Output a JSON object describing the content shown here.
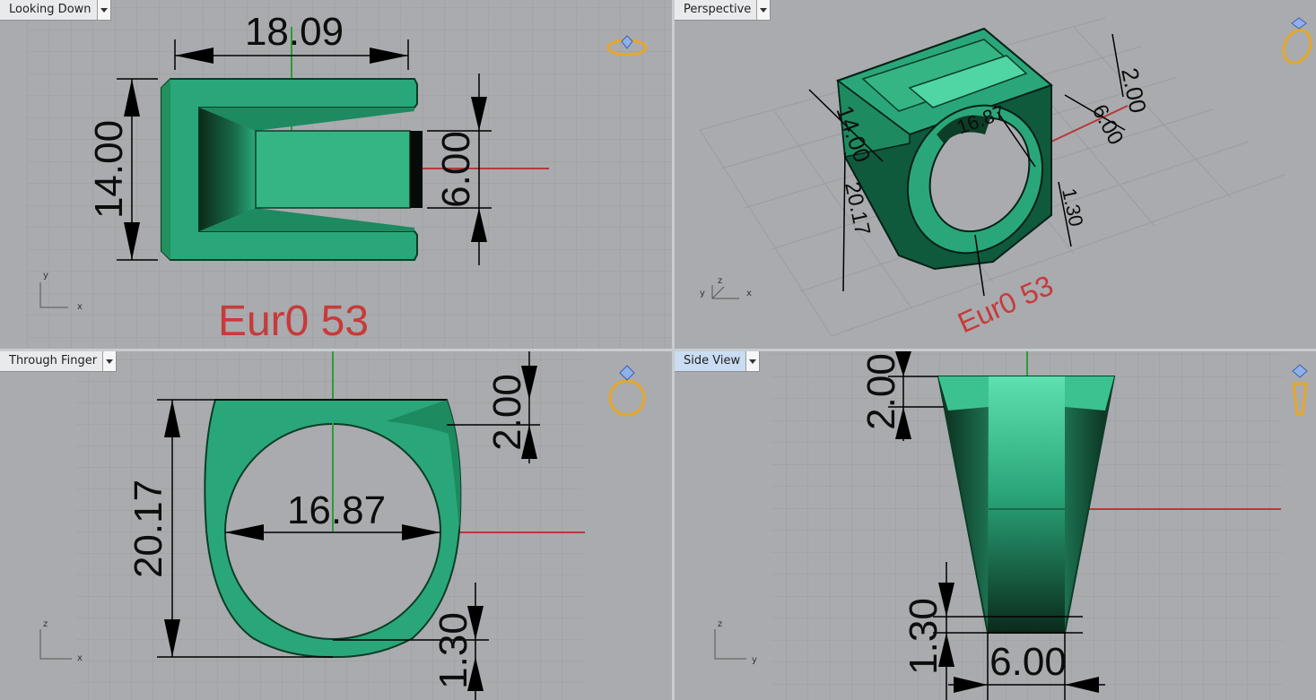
{
  "viewports": [
    {
      "title": "Looking Down",
      "active": false,
      "axes": {
        "v": "y",
        "h": "x"
      },
      "dimensions": [
        "18.09",
        "14.00",
        "6.00"
      ],
      "size_label": "Eur0 53"
    },
    {
      "title": "Perspective",
      "active": false,
      "axes": {
        "v": "y",
        "z": "z",
        "h": "x"
      },
      "dimensions": [
        "14.00",
        "2.00",
        "6.00",
        "20.17",
        "1.30",
        "16.87",
        "2.00"
      ],
      "size_label": "Eur0 53"
    },
    {
      "title": "Through Finger",
      "active": false,
      "axes": {
        "v": "z",
        "h": "x"
      },
      "dimensions": [
        "20.17",
        "16.87",
        "2.00",
        "1.30"
      ]
    },
    {
      "title": "Side View",
      "active": true,
      "axes": {
        "v": "z",
        "h": "y"
      },
      "dimensions": [
        "2.00",
        "1.30",
        "6.00"
      ]
    }
  ],
  "icons": [
    "ring-top-icon",
    "ring-perspective-icon",
    "ring-front-icon",
    "ring-side-icon",
    "dropdown-arrow-icon"
  ],
  "colors": {
    "viewport_bg": "#a9abae",
    "grid": "#9a9c9f",
    "model": "#2aa77a",
    "model_dark": "#0b3d27",
    "model_light": "#4fd6a4",
    "x_axis": "#b8383a",
    "y_axis": "#2f9a3a",
    "annotation_red": "#c83a3a",
    "active_tab": "#c9dcf2",
    "ring_icon": "#e6a82a"
  }
}
